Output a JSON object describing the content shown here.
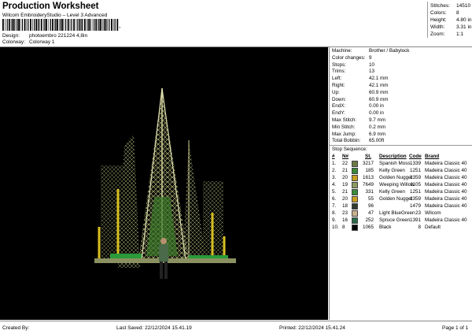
{
  "header": {
    "title": "Production Worksheet",
    "software": "Wilcom EmbroideryStudio – Level 3 Advanced",
    "barcode_text": ",",
    "design_label": "Design:",
    "design_value": "photoembro 221224 4,8in",
    "colorway_label": "Colorway:",
    "colorway_value": "Colorway 1"
  },
  "stats": [
    {
      "label": "Stitches:",
      "value": "14510"
    },
    {
      "label": "Colors:",
      "value": "8"
    },
    {
      "label": "Height:",
      "value": "4.80 in"
    },
    {
      "label": "Width:",
      "value": "3.31 in"
    },
    {
      "label": "Zoom:",
      "value": "1:1"
    }
  ],
  "machine_info": [
    {
      "label": "Machine:",
      "value": "Brother / Babylock"
    },
    {
      "label": "Color changes:",
      "value": "9"
    },
    {
      "label": "Stops:",
      "value": "10"
    },
    {
      "label": "Trims:",
      "value": "13"
    },
    {
      "label": "Left:",
      "value": "42.1 mm"
    },
    {
      "label": "Right:",
      "value": "42.1 mm"
    },
    {
      "label": "Up:",
      "value": "60.9 mm"
    },
    {
      "label": "Down:",
      "value": "60.9 mm"
    },
    {
      "label": "EndX:",
      "value": "0.00 in"
    },
    {
      "label": "EndY:",
      "value": "0.00 in"
    },
    {
      "label": "Max Stitch:",
      "value": "9.7 mm"
    },
    {
      "label": "Min Stitch:",
      "value": "0.2 mm"
    },
    {
      "label": "Max Jump:",
      "value": "6.9 mm"
    },
    {
      "label": "Total Bobbin:",
      "value": "65.00ft"
    }
  ],
  "stop_sequence": {
    "title": "Stop Sequence:",
    "headers": {
      "num": "#",
      "n": "N#",
      "st": "St.",
      "description": "Description",
      "code": "Code",
      "brand": "Brand"
    },
    "rows": [
      {
        "num": "1.",
        "n": "22",
        "color": "#6b7a45",
        "st": "3217",
        "description": "Spanish Moss",
        "code": "1339",
        "brand": "Madeira Classic 40"
      },
      {
        "num": "2.",
        "n": "21",
        "color": "#3a8a3a",
        "st": "185",
        "description": "Kelly Green",
        "code": "1251",
        "brand": "Madeira Classic 40"
      },
      {
        "num": "3.",
        "n": "20",
        "color": "#c8a020",
        "st": "1613",
        "description": "Golden Nugget",
        "code": "1359",
        "brand": "Madeira Classic 40"
      },
      {
        "num": "4.",
        "n": "19",
        "color": "#8a9a60",
        "st": "7649",
        "description": "Weeping Willow",
        "code": "1105",
        "brand": "Madeira Classic 40"
      },
      {
        "num": "5.",
        "n": "21",
        "color": "#3a8a3a",
        "st": "331",
        "description": "Kelly Green",
        "code": "1251",
        "brand": "Madeira Classic 40"
      },
      {
        "num": "6.",
        "n": "20",
        "color": "#c8a020",
        "st": "55",
        "description": "Golden Nugget",
        "code": "1359",
        "brand": "Madeira Classic 40"
      },
      {
        "num": "7.",
        "n": "18",
        "color": "#303a30",
        "st": "96",
        "description": "",
        "code": "1479",
        "brand": "Madeira Classic 40"
      },
      {
        "num": "8.",
        "n": "23",
        "color": "#c8b090",
        "st": "47",
        "description": "Light BlueGreen",
        "code": "23",
        "brand": "Wilcom"
      },
      {
        "num": "9.",
        "n": "16",
        "color": "#2a6a4a",
        "st": "252",
        "description": "Spruce Green",
        "code": "1391",
        "brand": "Madeira Classic 40"
      },
      {
        "num": "10.",
        "n": "8",
        "color": "#000000",
        "st": "1065",
        "description": "Black",
        "code": "8",
        "brand": "Default"
      }
    ]
  },
  "footer": {
    "created_by": "Created By:",
    "last_saved": "Last Saved: 22/12/2024 15.41.19",
    "printed": "Printed: 22/12/2024 15.41.24",
    "page": "Page 1 of 1"
  }
}
